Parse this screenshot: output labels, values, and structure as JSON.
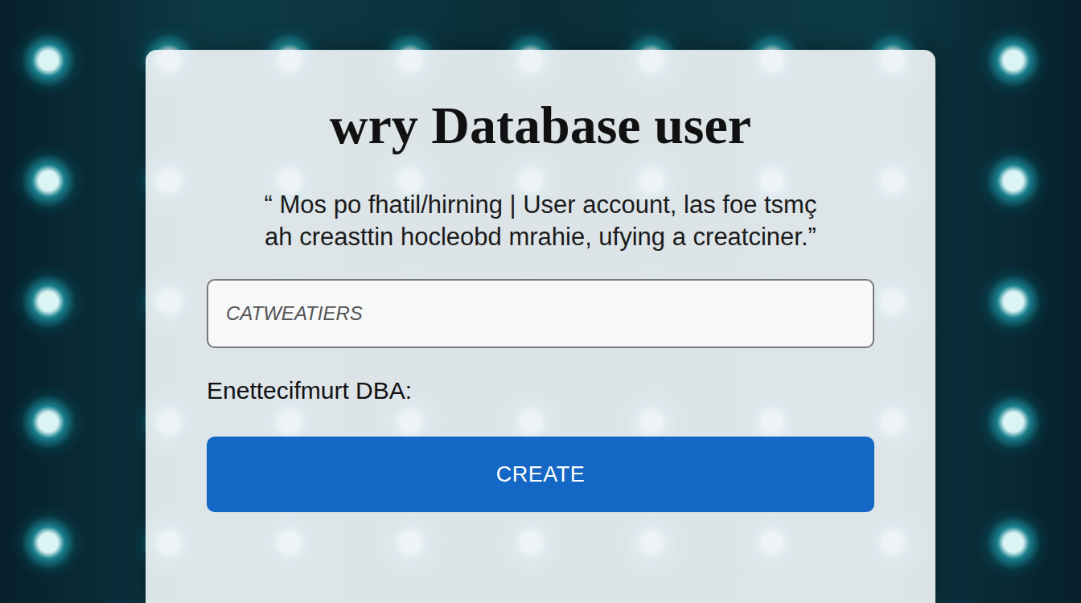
{
  "title": "wry Database user",
  "description": [
    "“ Mos po fhatil/hirning | User account, las foe tsmç",
    "ah creasttin hocleobd mrahie, ufying a creatciner.”"
  ],
  "field": {
    "placeholder": "CATWEATIERS"
  },
  "label": "Enettecifmurt DBA:",
  "button": "CREATE"
}
